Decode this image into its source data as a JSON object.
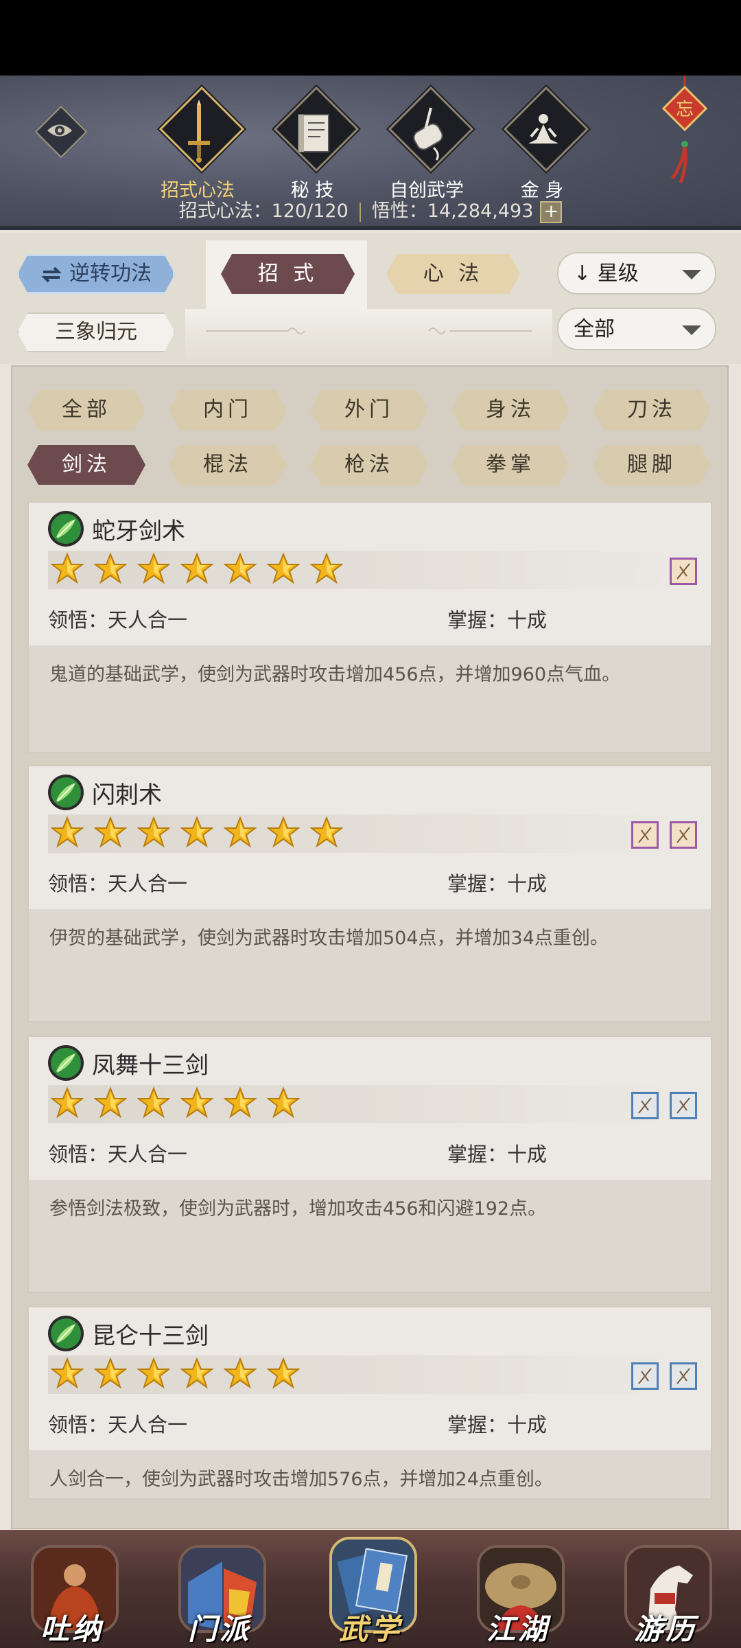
{
  "header": {
    "tabs": [
      {
        "label": "招式心法",
        "icon": "sword-icon",
        "active": true
      },
      {
        "label": "秘 技",
        "icon": "scroll-book-icon",
        "active": false
      },
      {
        "label": "自创武学",
        "icon": "brush-scroll-icon",
        "active": false
      },
      {
        "label": "金 身",
        "icon": "meditation-icon",
        "active": false
      }
    ],
    "stats": {
      "moves_label": "招式心法：120/120",
      "insight_label": "悟性：14,284,493"
    }
  },
  "filters": {
    "reverse_label": "逆转功法",
    "sanxiang_label": "三象归元",
    "moves_tab": "招 式",
    "heart_tab": "心 法",
    "sort_select": "星级",
    "scope_select": "全部"
  },
  "categories": [
    "全部",
    "内门",
    "外门",
    "身法",
    "刀法",
    "剑法",
    "棍法",
    "枪法",
    "拳掌",
    "腿脚"
  ],
  "active_category": "剑法",
  "skills": [
    {
      "name": "蛇牙剑术",
      "stars": 7,
      "insight": "领悟：天人合一",
      "mastery": "掌握：十成",
      "desc": "鬼道的基础武学，使剑为武器时攻击增加456点，并增加960点气血。",
      "books": [
        "purple"
      ]
    },
    {
      "name": "闪刺术",
      "stars": 7,
      "insight": "领悟：天人合一",
      "mastery": "掌握：十成",
      "desc": "伊贺的基础武学，使剑为武器时攻击增加504点，并增加34点重创。",
      "books": [
        "purple",
        "purple"
      ]
    },
    {
      "name": "凤舞十三剑",
      "stars": 6,
      "insight": "领悟：天人合一",
      "mastery": "掌握：十成",
      "desc": "参悟剑法极致，使剑为武器时，增加攻击456和闪避192点。",
      "books": [
        "blue",
        "blue"
      ]
    },
    {
      "name": "昆仑十三剑",
      "stars": 6,
      "insight": "领悟：天人合一",
      "mastery": "掌握：十成",
      "desc": "人剑合一，使剑为武器时攻击增加576点，并增加24点重创。",
      "books": [
        "blue",
        "blue"
      ]
    }
  ],
  "bottom_nav": [
    {
      "label": "吐纳",
      "active": false
    },
    {
      "label": "门派",
      "active": false
    },
    {
      "label": "武学",
      "active": true
    },
    {
      "label": "江湖",
      "active": false
    },
    {
      "label": "游历",
      "active": false
    }
  ],
  "colors": {
    "accent_gold": "#f6d27a",
    "active_pill": "#6d4a4d",
    "pill": "#d9ccae",
    "star": "#f2b51c"
  }
}
